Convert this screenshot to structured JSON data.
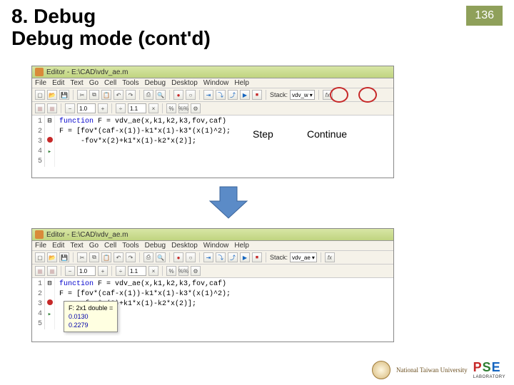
{
  "header": {
    "title_line1": "8. Debug",
    "title_line2": "Debug mode (cont'd)",
    "page_number": "136"
  },
  "annotations": {
    "step": "Step",
    "continue": "Continue"
  },
  "editor_top": {
    "title": "Editor - E:\\CAD\\vdv_ae.m",
    "menu": [
      "File",
      "Edit",
      "Text",
      "Go",
      "Cell",
      "Tools",
      "Debug",
      "Desktop",
      "Window",
      "Help"
    ],
    "font_minus": "−",
    "font_field": "1.0",
    "font_plus": "+",
    "div": "÷",
    "zoom_field": "1.1",
    "mult": "×",
    "stack_label": "Stack:",
    "stack_value": "vdv_w",
    "fx": "fx",
    "lines": [
      "1",
      "2",
      "3",
      "4",
      "5"
    ],
    "code1_pre": "function",
    "code1_post": " F = vdv_ae(x,k1,k2,k3,fov,caf)",
    "code2": "F = [fov*(caf-x(1))-k1*x(1)-k3*(x(1)^2);",
    "code3": "     -fov*x(2)+k1*x(1)-k2*x(2)];"
  },
  "editor_bottom": {
    "title": "Editor - E:\\CAD\\vdv_ae.m",
    "menu": [
      "File",
      "Edit",
      "Text",
      "Go",
      "Cell",
      "Tools",
      "Debug",
      "Desktop",
      "Window",
      "Help"
    ],
    "font_minus": "−",
    "font_field": "1.0",
    "font_plus": "+",
    "div": "÷",
    "zoom_field": "1.1",
    "mult": "×",
    "stack_label": "Stack:",
    "stack_value": "vdv_ae",
    "fx": "fx",
    "lines": [
      "1",
      "2",
      "3",
      "4",
      "5"
    ],
    "code1_pre": "function",
    "code1_post": " F = vdv_ae(x,k1,k2,k3,fov,caf)",
    "code2": "F = [fov*(caf-x(1))-k1*x(1)-k3*(x(1)^2);",
    "code3": "     -fov*x(2)+k1*x(1)-k2*x(2)];",
    "tooltip_header": "F: 2x1 double =",
    "tooltip_v1": "0.0130",
    "tooltip_v2": "0.2279"
  },
  "footer": {
    "university": "National Taiwan University",
    "pse_p": "P",
    "pse_s": "S",
    "pse_e": "E",
    "lab": "LABORATORY"
  }
}
